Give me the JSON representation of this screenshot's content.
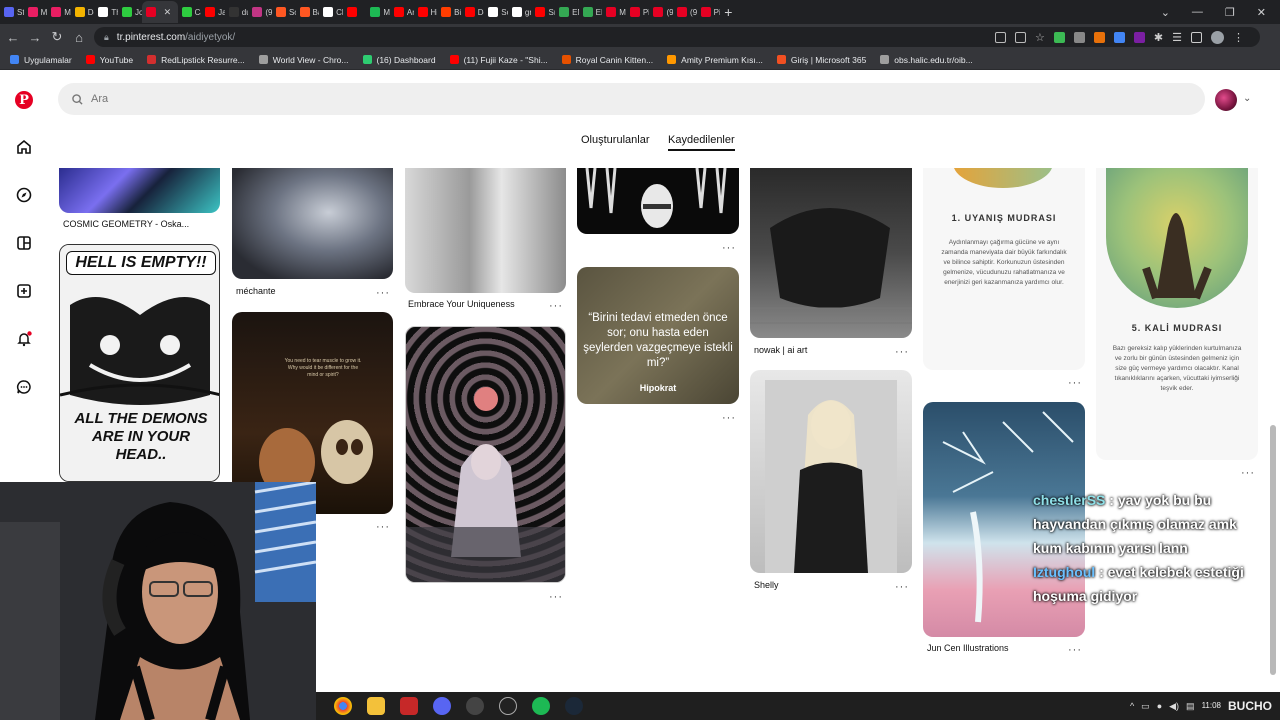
{
  "browser": {
    "tabs": [
      {
        "label": "Str",
        "color": "#5865f2"
      },
      {
        "label": "My",
        "color": "#e91e63"
      },
      {
        "label": "My",
        "color": "#e91e63"
      },
      {
        "label": "Do",
        "color": "#f4b400"
      },
      {
        "label": "Th",
        "color": "#ffffff"
      },
      {
        "label": "Jo",
        "color": "#2ecc40"
      },
      {
        "label": "",
        "color": "#e60023",
        "active": true
      },
      {
        "label": "Ca",
        "color": "#2ecc40"
      },
      {
        "label": "Jal",
        "color": "#ff0000"
      },
      {
        "label": "du",
        "color": "#333333"
      },
      {
        "label": "(9)",
        "color": "#c13584"
      },
      {
        "label": "Sci",
        "color": "#ff5722"
      },
      {
        "label": "Ba",
        "color": "#ff5722"
      },
      {
        "label": "Ch",
        "color": "#ffffff"
      },
      {
        "label": "",
        "color": "#ff0000"
      },
      {
        "label": "Mc",
        "color": "#1db954"
      },
      {
        "label": "An",
        "color": "#ff0000"
      },
      {
        "label": "Hit",
        "color": "#ff0000"
      },
      {
        "label": "Bü",
        "color": "#ff3d00"
      },
      {
        "label": "Dç",
        "color": "#ff0000"
      },
      {
        "label": "So",
        "color": "#ffffff"
      },
      {
        "label": "gri",
        "color": "#ffffff"
      },
      {
        "label": "Sır",
        "color": "#ff0000"
      },
      {
        "label": "EN",
        "color": "#34a853"
      },
      {
        "label": "EN",
        "color": "#34a853"
      },
      {
        "label": "M",
        "color": "#e60023"
      },
      {
        "label": "Pir",
        "color": "#e60023"
      },
      {
        "label": "(9",
        "color": "#e60023"
      },
      {
        "label": "(9",
        "color": "#e60023"
      },
      {
        "label": "Pir",
        "color": "#e60023"
      }
    ],
    "new_tab": "+",
    "url_domain": "tr.pinterest.com",
    "url_path": "/aidiyetyok/",
    "bookmarks": [
      {
        "label": "Uygulamalar",
        "color": "#4285f4"
      },
      {
        "label": "YouTube",
        "color": "#ff0000"
      },
      {
        "label": "RedLipstick Resurre...",
        "color": "#d32f2f"
      },
      {
        "label": "World View - Chro...",
        "color": "#9e9e9e"
      },
      {
        "label": "(16) Dashboard",
        "color": "#2ecc71"
      },
      {
        "label": "(11) Fujii Kaze - \"Shi...",
        "color": "#ff0000"
      },
      {
        "label": "Royal Canin Kitten...",
        "color": "#e65100"
      },
      {
        "label": "Amity Premium Kısı...",
        "color": "#ff9800"
      },
      {
        "label": "Giriş | Microsoft 365",
        "color": "#f25022"
      },
      {
        "label": "obs.halic.edu.tr/oib...",
        "color": "#9e9e9e"
      }
    ]
  },
  "pinterest": {
    "search_placeholder": "Ara",
    "tabs": {
      "created": "Oluşturulanlar",
      "saved": "Kaydedilenler"
    },
    "pins": [
      {
        "title": "COSMIC GEOMETRY - Oska..."
      },
      {
        "title": "méchante"
      },
      {
        "title": "Embrace Your Uniqueness"
      },
      {
        "title": "nowak | ai art"
      },
      {
        "title": "Shelly"
      },
      {
        "title": "Jun Cen Illustrations"
      }
    ],
    "comic_text_top": "HELL IS EMPTY!!",
    "comic_text_bottom": "ALL THE DEMONS ARE IN YOUR HEAD..",
    "quote_text": "“Birini tedavi etmeden önce sor; onu hasta eden şeylerden vazgeçmeye istekli mi?”",
    "quote_author": "Hipokrat",
    "mudra1_title": "1. UYANIŞ MUDRASI",
    "mudra1_body": "Aydınlanmayı çağırma gücüne ve aynı zamanda maneviyata dair büyük farkındalık ve bilince sahiptir. Korkunuzun üstesinden gelmenize, vücudunuzu rahatlatmanıza ve enerjinizi geri kazanmanıza yardımcı olur.",
    "mudra5_title": "5. KALİ MUDRASI",
    "mudra5_body": "Bazı gereksiz kalıp yüklerinden kurtulmanıza ve zorlu bir günün üstesinden gelmeniz için size güç vermeye yardımcı olacaktır. Kanal tıkanıklıklarını açarken, vücuttaki iyimserliği teşvik eder.",
    "painting_text": "You need to tear muscle to grow it. Why would it be different for the mind or spirit?"
  },
  "chat": [
    {
      "user": "chestlerSS",
      "message": ": yav yok bu bu hayvandan çıkmış olamaz amk kum kabının yarısı lann"
    },
    {
      "user": "Iztughoul",
      "message": ": evet kelebek estetiği hoşuma gidiyor"
    }
  ],
  "taskbar": {
    "time": "11:08",
    "tray_label": "BUCHO"
  }
}
